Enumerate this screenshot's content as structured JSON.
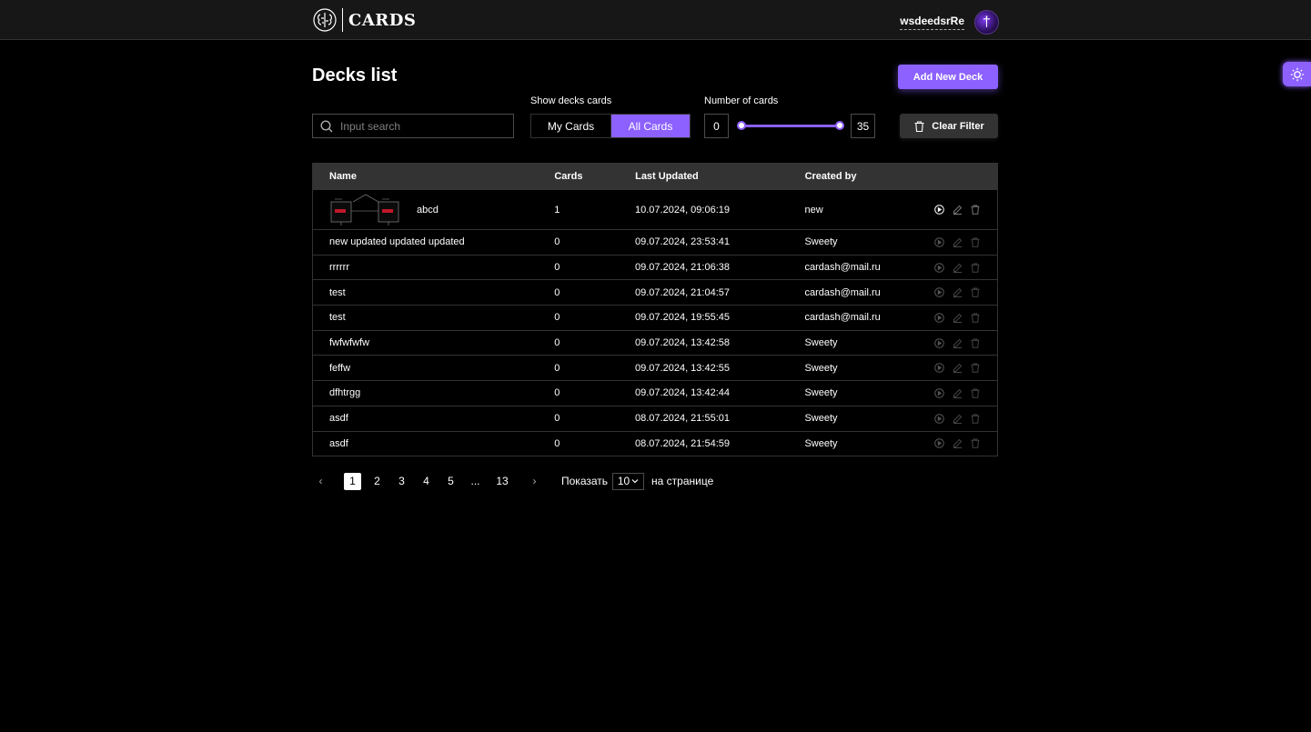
{
  "header": {
    "logo_text": "CARDS",
    "user_name": "wsdeedsrRe",
    "avatar_glyph": "†"
  },
  "page": {
    "title": "Decks list",
    "add_button": "Add New Deck"
  },
  "filters": {
    "search_placeholder": "Input search",
    "show_label": "Show decks cards",
    "tabs": [
      {
        "label": "My Cards",
        "active": false
      },
      {
        "label": "All Cards",
        "active": true
      }
    ],
    "number_label": "Number of cards",
    "min": "0",
    "max": "35",
    "clear_button": "Clear Filter"
  },
  "table": {
    "columns": [
      "Name",
      "Cards",
      "Last Updated",
      "Created by"
    ],
    "rows": [
      {
        "name": "abcd",
        "cards": "1",
        "updated": "10.07.2024, 09:06:19",
        "by": "new"
      },
      {
        "name": "new updated updated updated",
        "cards": "0",
        "updated": "09.07.2024, 23:53:41",
        "by": "Sweety"
      },
      {
        "name": "rrrrrr",
        "cards": "0",
        "updated": "09.07.2024, 21:06:38",
        "by": "cardash@mail.ru"
      },
      {
        "name": "test",
        "cards": "0",
        "updated": "09.07.2024, 21:04:57",
        "by": "cardash@mail.ru"
      },
      {
        "name": "test",
        "cards": "0",
        "updated": "09.07.2024, 19:55:45",
        "by": "cardash@mail.ru"
      },
      {
        "name": "fwfwfwfw",
        "cards": "0",
        "updated": "09.07.2024, 13:42:58",
        "by": "Sweety"
      },
      {
        "name": "feffw",
        "cards": "0",
        "updated": "09.07.2024, 13:42:55",
        "by": "Sweety"
      },
      {
        "name": "dfhtrgg",
        "cards": "0",
        "updated": "09.07.2024, 13:42:44",
        "by": "Sweety"
      },
      {
        "name": "asdf",
        "cards": "0",
        "updated": "08.07.2024, 21:55:01",
        "by": "Sweety"
      },
      {
        "name": "asdf",
        "cards": "0",
        "updated": "08.07.2024, 21:54:59",
        "by": "Sweety"
      }
    ]
  },
  "pagination": {
    "prev": "‹",
    "next": "›",
    "pages": [
      "1",
      "2",
      "3",
      "4",
      "5",
      "...",
      "13"
    ],
    "active_page": "1",
    "show_label": "Показать",
    "per_page": "10",
    "per_page_suffix": "на странице"
  },
  "colors": {
    "accent": "#8c61ff",
    "background": "#000000",
    "header": "#171717",
    "border": "#333333"
  }
}
